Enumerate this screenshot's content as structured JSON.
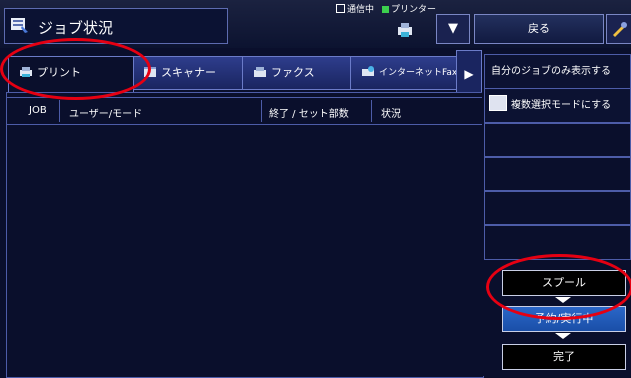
{
  "header": {
    "title": "ジョブ状況",
    "status_comm": "通信中",
    "status_printer": "プリンター",
    "back_label": "戻る",
    "dropdown_glyph": "▼"
  },
  "tabs": [
    {
      "label": "プリント",
      "active": true
    },
    {
      "label": "スキャナー",
      "active": false
    },
    {
      "label": "ファクス",
      "active": false
    },
    {
      "label": "インターネットFax",
      "active": false
    }
  ],
  "table": {
    "columns": [
      "JOB",
      "ユーザー/モード",
      "終了 / セット部数",
      "状況"
    ]
  },
  "sidebar": {
    "own_jobs_label": "自分のジョブのみ表示する",
    "multi_select_label": "複数選択モードにする"
  },
  "steps": [
    {
      "label": "スプール",
      "active": false
    },
    {
      "label": "予約/実行中",
      "active": true
    },
    {
      "label": "完了",
      "active": false
    }
  ],
  "colors": {
    "background": "#0a0f2c",
    "highlight_ring": "#e60012",
    "active_step": "#1a4fa8",
    "status_green": "#3ccf4e"
  }
}
